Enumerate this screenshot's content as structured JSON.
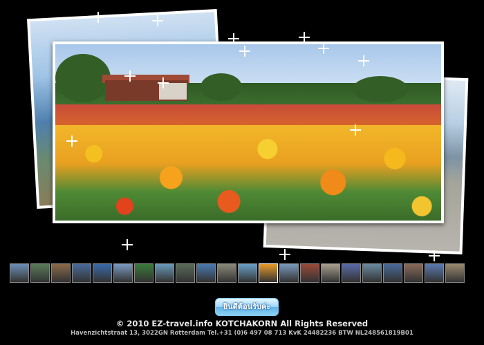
{
  "gallery": {
    "thumbnails": [
      {
        "color": "#6b8fb5"
      },
      {
        "color": "#5a7a5a"
      },
      {
        "color": "#8a6a4a"
      },
      {
        "color": "#4a6a9a"
      },
      {
        "color": "#3a6aa8"
      },
      {
        "color": "#7a9ac0"
      },
      {
        "color": "#3a7a3a"
      },
      {
        "color": "#6a9ab8"
      },
      {
        "color": "#5a6a5a"
      },
      {
        "color": "#4a7ab0"
      },
      {
        "color": "#8a8a7a"
      },
      {
        "color": "#6aa0c8"
      },
      {
        "color": "#e89a2a"
      },
      {
        "color": "#7a9aba"
      },
      {
        "color": "#9a4a3a"
      },
      {
        "color": "#a8a090"
      },
      {
        "color": "#5a6aa8"
      },
      {
        "color": "#6a8aa0"
      },
      {
        "color": "#4a6a9a"
      },
      {
        "color": "#8a6a5a"
      },
      {
        "color": "#5a7ab0"
      },
      {
        "color": "#9a8a70"
      }
    ],
    "active_index": 12
  },
  "welcome_button": {
    "label": "ยินดีต้อนรับค่ะ"
  },
  "footer": {
    "copyright": "© 2010 EZ-travel.info  KOTCHAKORN All Rights Reserved",
    "address": "Havenzichtstraat 13, 3022GN Rotterdam Tel.+31 (0)6 497 08 713 KvK 24482236 BTW NL248561819B01"
  }
}
